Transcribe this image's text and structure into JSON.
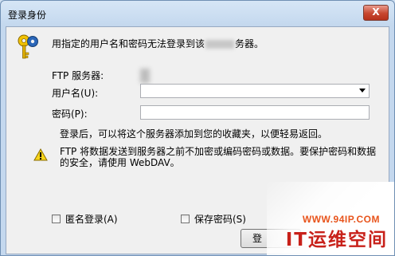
{
  "window": {
    "title": "登录身份",
    "close_glyph": "X"
  },
  "message": {
    "prefix": "用指定的用户名和密码无法登录到该",
    "suffix": "务器。"
  },
  "form": {
    "ftp_server_label": "FTP 服务器:",
    "username_label": "用户名(U):",
    "username_value": "",
    "password_label": "密码(P):",
    "password_value": ""
  },
  "info_text": "登录后，可以将这个服务器添加到您的收藏夹，以便轻易返回。",
  "warning_text": "FTP 将数据发送到服务器之前不加密或编码密码或数据。要保护密码和数据的安全，请使用 WebDAV。",
  "checkboxes": {
    "anonymous_label": "匿名登录(A)",
    "save_password_label": "保存密码(S)"
  },
  "buttons": {
    "ok_label": "登"
  },
  "watermark": {
    "url": "WWW.94IP.COM",
    "brand": "IT运维空间"
  },
  "icons": {
    "key": "key-icon",
    "warning": "warning-icon",
    "dropdown": "chevron-down-icon"
  }
}
